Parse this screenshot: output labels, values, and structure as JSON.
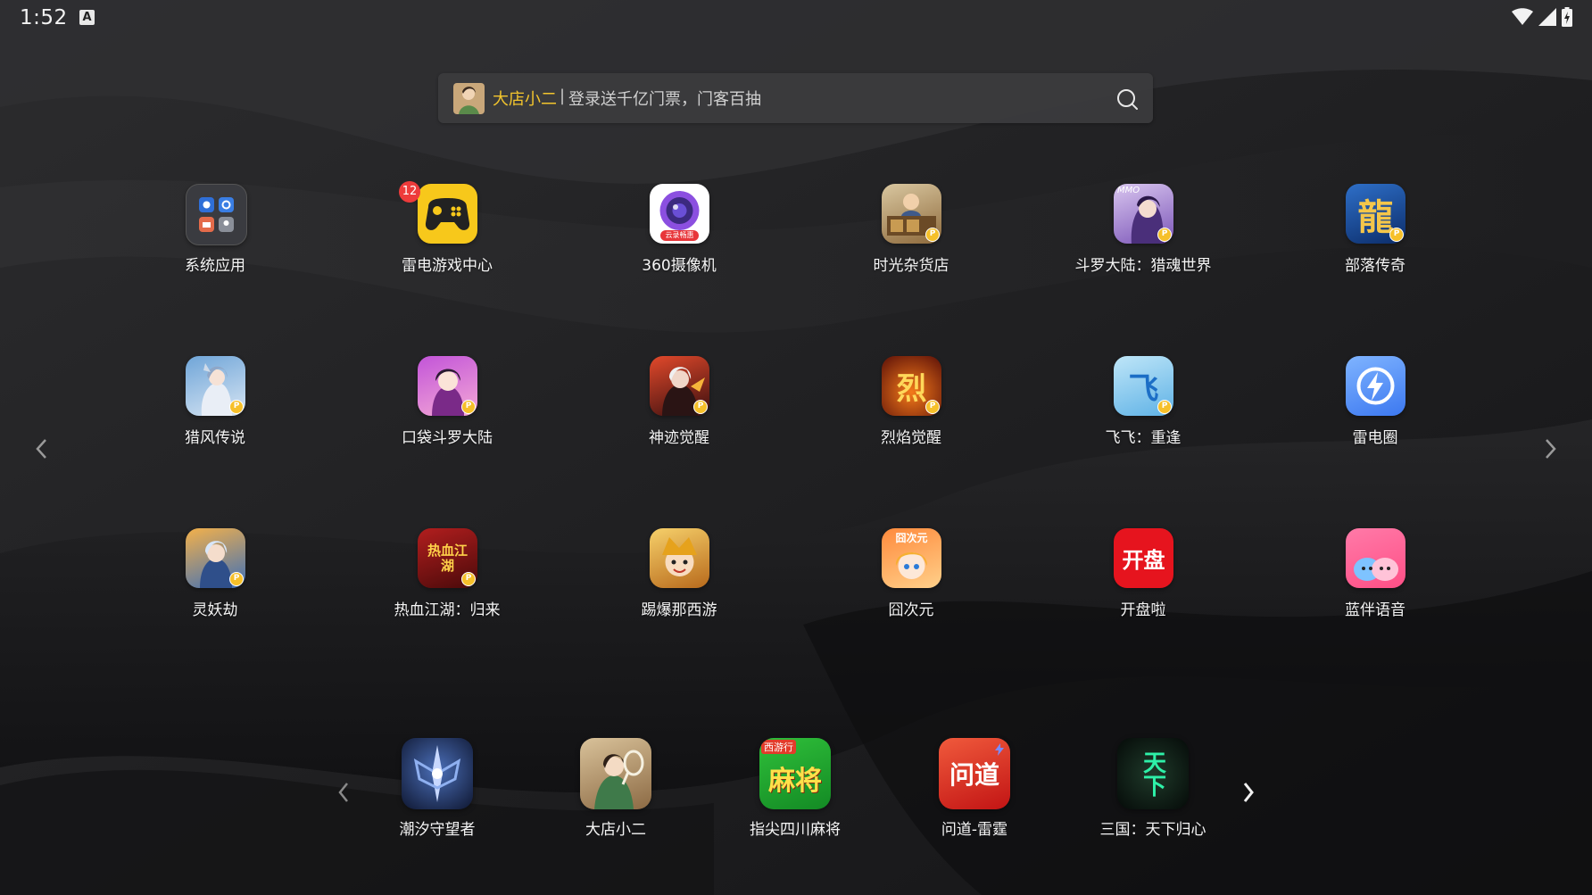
{
  "status_bar": {
    "time": "1:52",
    "notification_icon": "a-letter-icon",
    "wifi_icon": "wifi-icon",
    "signal_icon": "signal-icon",
    "battery_icon": "battery-icon"
  },
  "search": {
    "brand": "大店小二",
    "separator": "|",
    "promo": "登录送千亿门票，门客百抽",
    "icon": "search-icon"
  },
  "grid": [
    {
      "label": "系统应用",
      "icon": "folder-icon"
    },
    {
      "label": "雷电游戏中心",
      "icon": "gamepad-icon",
      "badge": "12"
    },
    {
      "label": "360摄像机",
      "icon": "camera-icon",
      "tag": "云录畅惠"
    },
    {
      "label": "时光杂货店",
      "icon": "game-shop-icon",
      "coin": true
    },
    {
      "label": "斗罗大陆：猎魂世界",
      "icon": "game-character-icon",
      "tag": "MMO",
      "coin": true
    },
    {
      "label": "部落传奇",
      "icon": "dragon-glyph-icon",
      "glyph": "龍",
      "coin": true
    },
    {
      "label": "猎风传说",
      "icon": "game-character-icon",
      "coin": true
    },
    {
      "label": "口袋斗罗大陆",
      "icon": "game-character-icon",
      "coin": true
    },
    {
      "label": "神迹觉醒",
      "icon": "game-character-icon",
      "coin": true
    },
    {
      "label": "烈焰觉醒",
      "icon": "flame-glyph-icon",
      "glyph": "烈",
      "coin": true
    },
    {
      "label": "飞飞：重逢",
      "icon": "game-logo-icon",
      "glyph": "飞",
      "coin": true
    },
    {
      "label": "雷电圈",
      "icon": "lightning-icon"
    },
    {
      "label": "灵妖劫",
      "icon": "game-character-icon",
      "coin": true
    },
    {
      "label": "热血江湖：归来",
      "icon": "game-logo-icon",
      "glyph": "热血江湖",
      "coin": true
    },
    {
      "label": "踢爆那西游",
      "icon": "game-character-icon"
    },
    {
      "label": "囧次元",
      "icon": "anime-girl-icon",
      "tag": "囧次元"
    },
    {
      "label": "开盘啦",
      "icon": "kaipan-logo-icon",
      "glyph": "开盘"
    },
    {
      "label": "蓝伴语音",
      "icon": "mascot-icon"
    }
  ],
  "dock": [
    {
      "label": "潮汐守望者",
      "icon": "sword-emblem-icon"
    },
    {
      "label": "大店小二",
      "icon": "game-character-icon"
    },
    {
      "label": "指尖四川麻将",
      "icon": "mahjong-icon",
      "glyph": "麻将",
      "tag": "西游行"
    },
    {
      "label": "问道-雷霆",
      "icon": "wendao-logo-icon",
      "glyph": "问道"
    },
    {
      "label": "三国：天下归心",
      "icon": "calligraphy-icon",
      "glyph": "天下"
    }
  ],
  "colors": {
    "brand_yellow": "#f3c52d",
    "badge_red": "#ee3b3b",
    "coin_gold": "#f6c02a"
  }
}
